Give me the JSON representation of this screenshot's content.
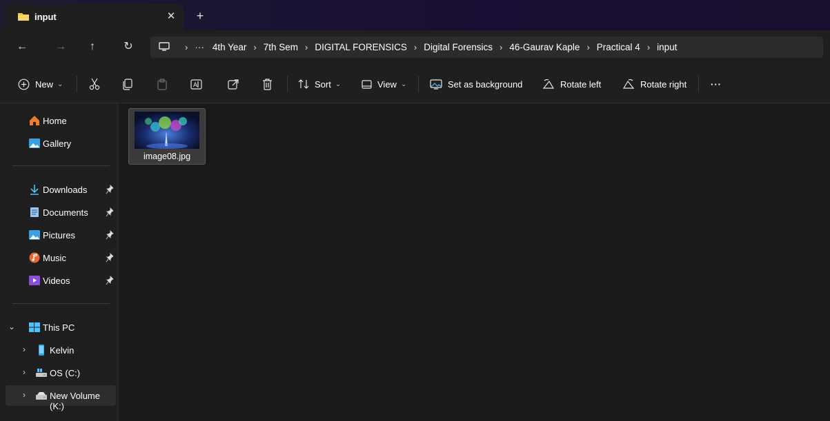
{
  "tab": {
    "title": "input",
    "close_glyph": "✕",
    "new_tab_glyph": "+"
  },
  "nav": {
    "back_glyph": "←",
    "forward_glyph": "→",
    "up_glyph": "↑",
    "refresh_glyph": "↻",
    "more_glyph": "···",
    "breadcrumb": [
      "4th Year",
      "7th Sem",
      "DIGITAL FORENSICS",
      "Digital Forensics",
      "46-Gaurav Kaple",
      "Practical 4",
      "input"
    ],
    "sep_glyph": "›"
  },
  "commands": {
    "new": "New",
    "sort": "Sort",
    "view": "View",
    "set_background": "Set as background",
    "rotate_left": "Rotate left",
    "rotate_right": "Rotate right",
    "more": "···"
  },
  "sidebar": {
    "home": "Home",
    "gallery": "Gallery",
    "quick": [
      {
        "label": "Downloads"
      },
      {
        "label": "Documents"
      },
      {
        "label": "Pictures"
      },
      {
        "label": "Music"
      },
      {
        "label": "Videos"
      }
    ],
    "this_pc": "This PC",
    "drives": [
      {
        "label": "Kelvin"
      },
      {
        "label": "OS (C:)"
      },
      {
        "label": "New Volume (K:)"
      }
    ],
    "expand_glyph": "›",
    "collapse_glyph": "⌄"
  },
  "files": [
    {
      "name": "image08.jpg"
    }
  ],
  "colors": {
    "accent": "#4cc2ff",
    "folder": "#f4c443",
    "background": "#191919",
    "panel": "#1f1f1f"
  }
}
